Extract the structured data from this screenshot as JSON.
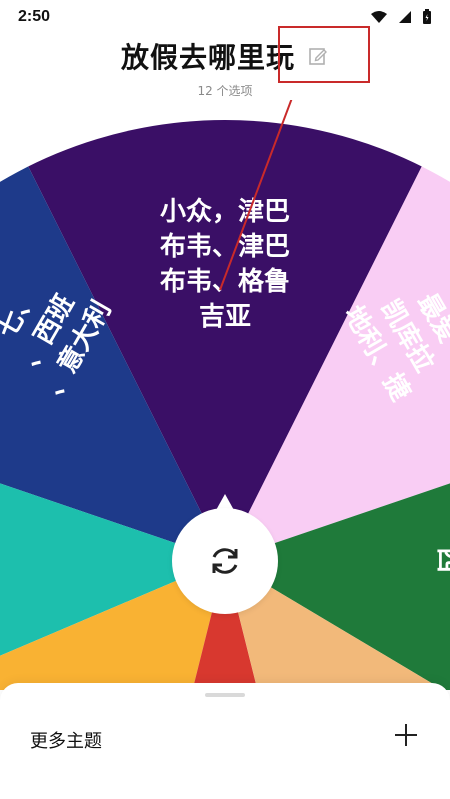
{
  "status": {
    "time": "2:50"
  },
  "header": {
    "title": "放假去哪里玩",
    "subtitle": "12 个选项"
  },
  "wheel": {
    "segments": [
      {
        "label": "小众，津巴布韦、津巴布韦、格鲁吉亚",
        "lines": [
          "小众，津巴",
          "布韦、津巴",
          "布韦、格鲁",
          "吉亚"
        ],
        "color": "#3a0f66"
      },
      {
        "label": "...、西班牙、意大利",
        "lines": [
          "七、",
          "、西班",
          "、意大利",
          "、"
        ],
        "color": "#1e3a8a"
      },
      {
        "label": "最爱、凯库拉、地利、捷...",
        "lines": [
          "最爱",
          "凯库拉",
          "地利、捷"
        ],
        "color": "#f9cdf4"
      },
      {
        "label": "西...",
        "lines": [
          "西"
        ],
        "color": "#1f7a3a"
      },
      {
        "label": "",
        "lines": [],
        "color": "#f2b97a"
      },
      {
        "label": "",
        "lines": [],
        "color": "#d8382f"
      },
      {
        "label": "",
        "lines": [],
        "color": "#f9b233"
      },
      {
        "label": "",
        "lines": [],
        "color": "#1dbfad"
      }
    ]
  },
  "bottom_sheet": {
    "more_themes_label": "更多主题"
  }
}
